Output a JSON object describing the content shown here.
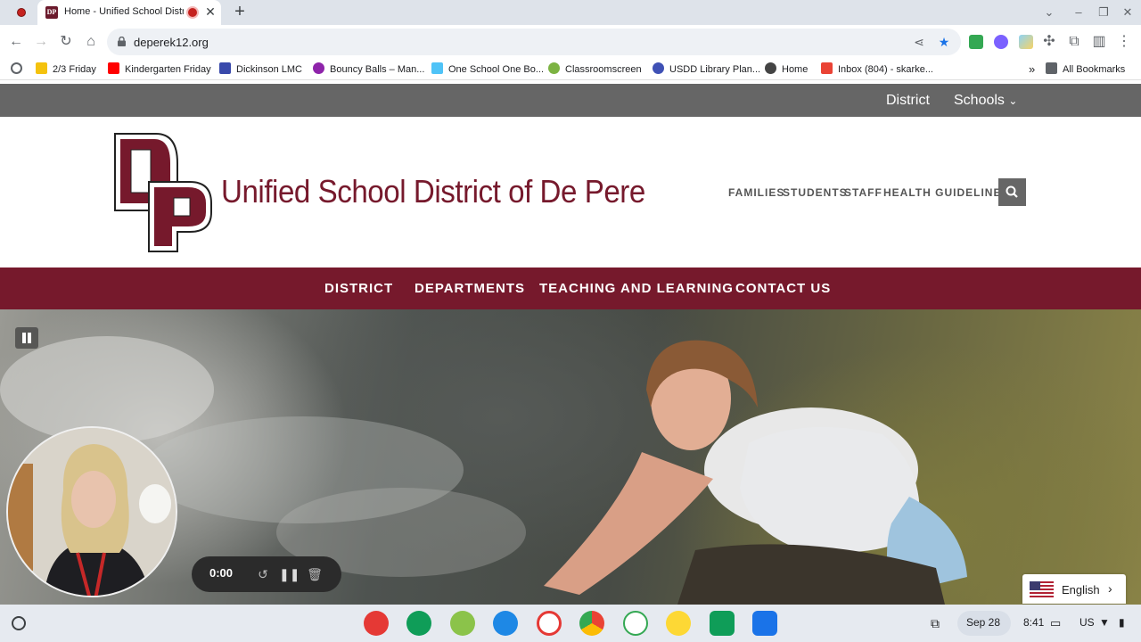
{
  "browser": {
    "tab_title": "Home - Unified School District of De Pere",
    "url": "deperek12.org",
    "bookmarks": [
      {
        "label": "2/3 Friday",
        "color": "#f4c20d"
      },
      {
        "label": "Kindergarten Friday",
        "color": "#ff0000"
      },
      {
        "label": "Dickinson LMC",
        "color": "#3949ab"
      },
      {
        "label": "Bouncy Balls – Man...",
        "color": "#8e24aa"
      },
      {
        "label": "One School One Bo...",
        "color": "#4fc3f7"
      },
      {
        "label": "Classroomscreen",
        "color": "#7cb342"
      },
      {
        "label": "USDD Library Plan...",
        "color": "#3f51b5"
      },
      {
        "label": "Home",
        "color": "#444444"
      },
      {
        "label": "Inbox (804) - skarke...",
        "color": "#ea4335"
      }
    ],
    "bookmarks_overflow": "»",
    "all_bookmarks": "All Bookmarks"
  },
  "site": {
    "top_nav": [
      "District",
      "Schools"
    ],
    "logo_letters": "DP",
    "title": "Unified School District of De Pere",
    "utility_nav": [
      "FAMILIES",
      "STUDENTS",
      "STAFF",
      "HEALTH GUIDELINES"
    ],
    "main_nav": [
      "DISTRICT",
      "DEPARTMENTS",
      "TEACHING AND LEARNING",
      "CONTACT US"
    ],
    "brand_color": "#76192c",
    "language": "English"
  },
  "recorder": {
    "time": "0:00"
  },
  "shelf": {
    "date": "Sep 28",
    "time": "8:41",
    "locale": "US"
  }
}
